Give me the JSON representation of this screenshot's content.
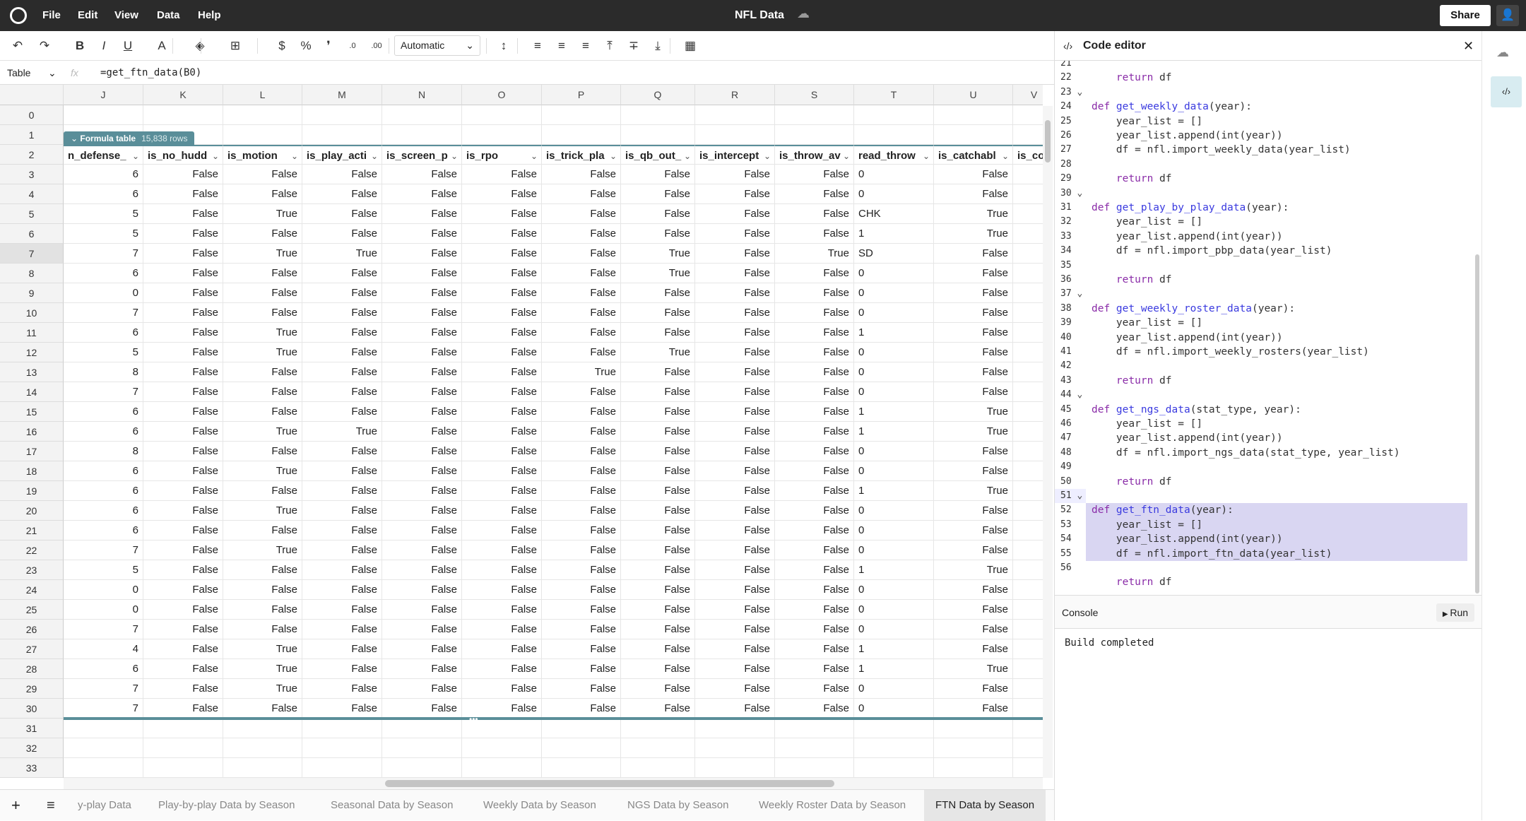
{
  "app": {
    "title": "NFL Data",
    "menu": [
      "File",
      "Edit",
      "View",
      "Data",
      "Help"
    ],
    "share": "Share"
  },
  "toolbar": {
    "number_format": "Automatic",
    "icons": [
      "undo-icon",
      "redo-icon",
      "bold-icon",
      "italic-icon",
      "underline-icon",
      "text-color-icon",
      "fill-color-icon",
      "borders-icon",
      "currency-icon",
      "percent-icon",
      "comma-icon",
      "decrease-decimal-icon",
      "increase-decimal-icon",
      "wrap-icon",
      "align-left-icon",
      "align-center-icon",
      "align-right-icon",
      "valign-top-icon",
      "valign-middle-icon",
      "valign-bottom-icon",
      "insert-chart-icon"
    ]
  },
  "formula_bar": {
    "name_box": "Table",
    "fx": "fx",
    "formula": "=get_ftn_data(B0)"
  },
  "grid": {
    "columns": [
      "J",
      "K",
      "L",
      "M",
      "N",
      "O",
      "P",
      "Q",
      "R",
      "S",
      "T",
      "U",
      "V"
    ],
    "row_numbers": [
      0,
      1,
      2,
      3,
      4,
      5,
      6,
      7,
      8,
      9,
      10,
      11,
      12,
      13,
      14,
      15,
      16,
      17,
      18,
      19,
      20,
      21,
      22,
      23,
      24,
      25,
      26,
      27,
      28,
      29,
      30,
      31,
      32,
      33
    ],
    "selected_row": 7,
    "table_badge": {
      "label": "Formula table",
      "rows": "15,838 rows"
    },
    "headers": [
      "n_defense_",
      "is_no_hudd",
      "is_motion",
      "is_play_acti",
      "is_screen_p",
      "is_rpo",
      "is_trick_pla",
      "is_qb_out_",
      "is_intercept",
      "is_throw_av",
      "read_throw",
      "is_catchabl",
      "is_co"
    ],
    "rows": [
      [
        "6",
        "False",
        "False",
        "False",
        "False",
        "False",
        "False",
        "False",
        "False",
        "False",
        "0",
        "False"
      ],
      [
        "6",
        "False",
        "False",
        "False",
        "False",
        "False",
        "False",
        "False",
        "False",
        "False",
        "0",
        "False"
      ],
      [
        "5",
        "False",
        "True",
        "False",
        "False",
        "False",
        "False",
        "False",
        "False",
        "False",
        "CHK",
        "True"
      ],
      [
        "5",
        "False",
        "False",
        "False",
        "False",
        "False",
        "False",
        "False",
        "False",
        "False",
        "1",
        "True"
      ],
      [
        "7",
        "False",
        "True",
        "True",
        "False",
        "False",
        "False",
        "True",
        "False",
        "True",
        "SD",
        "False"
      ],
      [
        "6",
        "False",
        "False",
        "False",
        "False",
        "False",
        "False",
        "True",
        "False",
        "False",
        "0",
        "False"
      ],
      [
        "0",
        "False",
        "False",
        "False",
        "False",
        "False",
        "False",
        "False",
        "False",
        "False",
        "0",
        "False"
      ],
      [
        "7",
        "False",
        "False",
        "False",
        "False",
        "False",
        "False",
        "False",
        "False",
        "False",
        "0",
        "False"
      ],
      [
        "6",
        "False",
        "True",
        "False",
        "False",
        "False",
        "False",
        "False",
        "False",
        "False",
        "1",
        "False"
      ],
      [
        "5",
        "False",
        "True",
        "False",
        "False",
        "False",
        "False",
        "True",
        "False",
        "False",
        "0",
        "False"
      ],
      [
        "8",
        "False",
        "False",
        "False",
        "False",
        "False",
        "True",
        "False",
        "False",
        "False",
        "0",
        "False"
      ],
      [
        "7",
        "False",
        "False",
        "False",
        "False",
        "False",
        "False",
        "False",
        "False",
        "False",
        "0",
        "False"
      ],
      [
        "6",
        "False",
        "False",
        "False",
        "False",
        "False",
        "False",
        "False",
        "False",
        "False",
        "1",
        "True"
      ],
      [
        "6",
        "False",
        "True",
        "True",
        "False",
        "False",
        "False",
        "False",
        "False",
        "False",
        "1",
        "True"
      ],
      [
        "8",
        "False",
        "False",
        "False",
        "False",
        "False",
        "False",
        "False",
        "False",
        "False",
        "0",
        "False"
      ],
      [
        "6",
        "False",
        "True",
        "False",
        "False",
        "False",
        "False",
        "False",
        "False",
        "False",
        "0",
        "False"
      ],
      [
        "6",
        "False",
        "False",
        "False",
        "False",
        "False",
        "False",
        "False",
        "False",
        "False",
        "1",
        "True"
      ],
      [
        "6",
        "False",
        "True",
        "False",
        "False",
        "False",
        "False",
        "False",
        "False",
        "False",
        "0",
        "False"
      ],
      [
        "6",
        "False",
        "False",
        "False",
        "False",
        "False",
        "False",
        "False",
        "False",
        "False",
        "0",
        "False"
      ],
      [
        "7",
        "False",
        "True",
        "False",
        "False",
        "False",
        "False",
        "False",
        "False",
        "False",
        "0",
        "False"
      ],
      [
        "5",
        "False",
        "False",
        "False",
        "False",
        "False",
        "False",
        "False",
        "False",
        "False",
        "1",
        "True"
      ],
      [
        "0",
        "False",
        "False",
        "False",
        "False",
        "False",
        "False",
        "False",
        "False",
        "False",
        "0",
        "False"
      ],
      [
        "0",
        "False",
        "False",
        "False",
        "False",
        "False",
        "False",
        "False",
        "False",
        "False",
        "0",
        "False"
      ],
      [
        "7",
        "False",
        "False",
        "False",
        "False",
        "False",
        "False",
        "False",
        "False",
        "False",
        "0",
        "False"
      ],
      [
        "4",
        "False",
        "True",
        "False",
        "False",
        "False",
        "False",
        "False",
        "False",
        "False",
        "1",
        "False"
      ],
      [
        "6",
        "False",
        "True",
        "False",
        "False",
        "False",
        "False",
        "False",
        "False",
        "False",
        "1",
        "True"
      ],
      [
        "7",
        "False",
        "True",
        "False",
        "False",
        "False",
        "False",
        "False",
        "False",
        "False",
        "0",
        "False"
      ],
      [
        "7",
        "False",
        "False",
        "False",
        "False",
        "False",
        "False",
        "False",
        "False",
        "False",
        "0",
        "False"
      ]
    ]
  },
  "sheet_tabs": {
    "items": [
      "y-play Data",
      "Play-by-play Data by Season",
      "Seasonal Data by Season",
      "Weekly Data by Season",
      "NGS Data by Season",
      "Weekly Roster Data by Season",
      "FTN Data by Season"
    ],
    "active": "FTN Data by Season"
  },
  "code_editor": {
    "title": "Code editor",
    "first_line": 21,
    "active_line": 51,
    "fold_lines": [
      23,
      30,
      37,
      44,
      51
    ],
    "highlight_lines": [
      52,
      53,
      54,
      55
    ],
    "lines": [
      "",
      "    return df",
      "",
      "def get_weekly_data(year):",
      "    year_list = []",
      "    year_list.append(int(year))",
      "    df = nfl.import_weekly_data(year_list)",
      "",
      "    return df",
      "",
      "def get_play_by_play_data(year):",
      "    year_list = []",
      "    year_list.append(int(year))",
      "    df = nfl.import_pbp_data(year_list)",
      "",
      "    return df",
      "",
      "def get_weekly_roster_data(year):",
      "    year_list = []",
      "    year_list.append(int(year))",
      "    df = nfl.import_weekly_rosters(year_list)",
      "",
      "    return df",
      "",
      "def get_ngs_data(stat_type, year):",
      "    year_list = []",
      "    year_list.append(int(year))",
      "    df = nfl.import_ngs_data(stat_type, year_list)",
      "",
      "    return df",
      "",
      "def get_ftn_data(year):",
      "    year_list = []",
      "    year_list.append(int(year))",
      "    df = nfl.import_ftn_data(year_list)",
      "",
      "    return df"
    ],
    "console_label": "Console",
    "run_label": "Run",
    "console_output": "Build completed"
  },
  "colors": {
    "topbar": "#2b2b2b",
    "table_accent": "#5a8e99",
    "highlight": "#d9d6f2"
  }
}
